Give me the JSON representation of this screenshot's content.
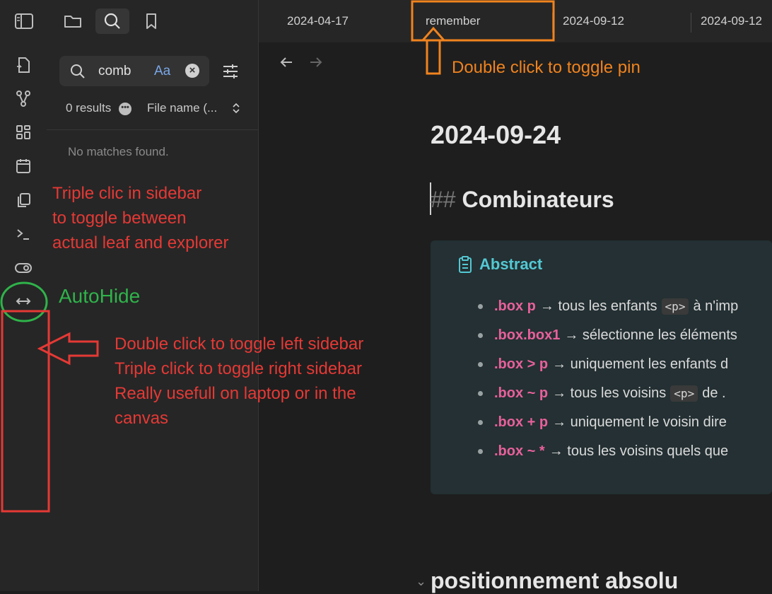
{
  "tabs": [
    "2024-04-17",
    "remember",
    "2024-09-12",
    "2024-09-12"
  ],
  "search": {
    "query": "comb",
    "match_case_label": "Aa",
    "results_label": "0 results",
    "sort_label": "File name (...",
    "no_matches": "No matches found."
  },
  "document": {
    "title": "2024-09-24",
    "heading_hash": "##",
    "heading": "Combinateurs",
    "callout_title": "Abstract",
    "bullets": [
      {
        "selector": ".box p",
        "pre": "→ tous les enfants",
        "code": "<p>",
        "post": "à n'imp"
      },
      {
        "selector": ".box.box1",
        "pre": "→ sélectionne les éléments",
        "code": "",
        "post": ""
      },
      {
        "selector": ".box > p",
        "pre": "→ uniquement les enfants d",
        "code": "",
        "post": ""
      },
      {
        "selector": ".box ~ p",
        "pre": "→ tous les voisins",
        "code": "<p>",
        "post": "de  ."
      },
      {
        "selector": ".box + p",
        "pre": "→ uniquement le voisin dire",
        "code": "",
        "post": ""
      },
      {
        "selector": ".box ~ *",
        "pre": "→ tous les voisins quels que",
        "code": "",
        "post": ""
      }
    ],
    "next_heading": "positionnement absolu"
  },
  "annotations": {
    "pin": "Double click to toggle pin",
    "sidebar": [
      "Triple clic in sidebar",
      "to toggle between",
      "actual leaf and explorer"
    ],
    "autohide": "AutoHide",
    "toggle": [
      "Double click to toggle left sidebar",
      "Triple click to toggle right sidebar",
      "Really usefull on laptop or in the",
      "canvas"
    ]
  },
  "colors": {
    "accent_red": "#e53935",
    "accent_orange": "#f0831e",
    "accent_green": "#2fb34a",
    "selector_pink": "#e9609b",
    "callout_cyan": "#53c8d3"
  }
}
